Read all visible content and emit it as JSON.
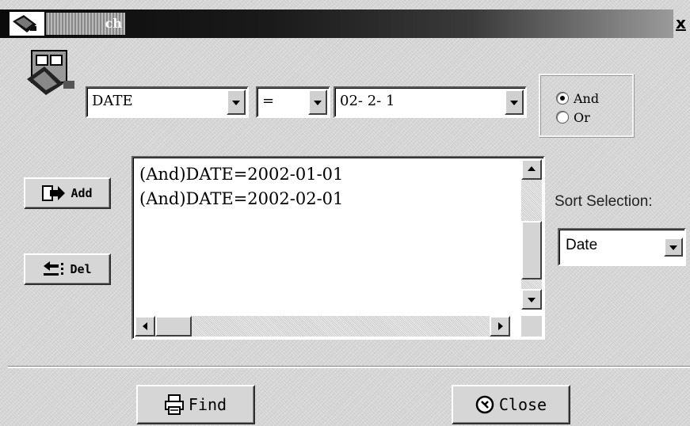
{
  "window": {
    "title": "ch",
    "close_glyph": "x",
    "icons": {
      "title": "dialog-app-icon",
      "app": "search-database-icon"
    }
  },
  "criteria": {
    "field": {
      "value": "DATE",
      "options_visible": [
        "DATE"
      ]
    },
    "operator": {
      "value": "="
    },
    "value": {
      "value": "02- 2- 1"
    },
    "logic": {
      "options": [
        {
          "label": "And",
          "checked": true
        },
        {
          "label": "Or",
          "checked": false
        }
      ]
    }
  },
  "buttons": {
    "add_label": "Add",
    "del_label": "Del",
    "find_label": "Find",
    "close_label": "Close"
  },
  "conditions_list": {
    "items": [
      "(And)DATE=2002-01-01",
      "(And)DATE=2002-02-01"
    ]
  },
  "sort": {
    "label": "Sort Selection:",
    "value": "Date"
  }
}
